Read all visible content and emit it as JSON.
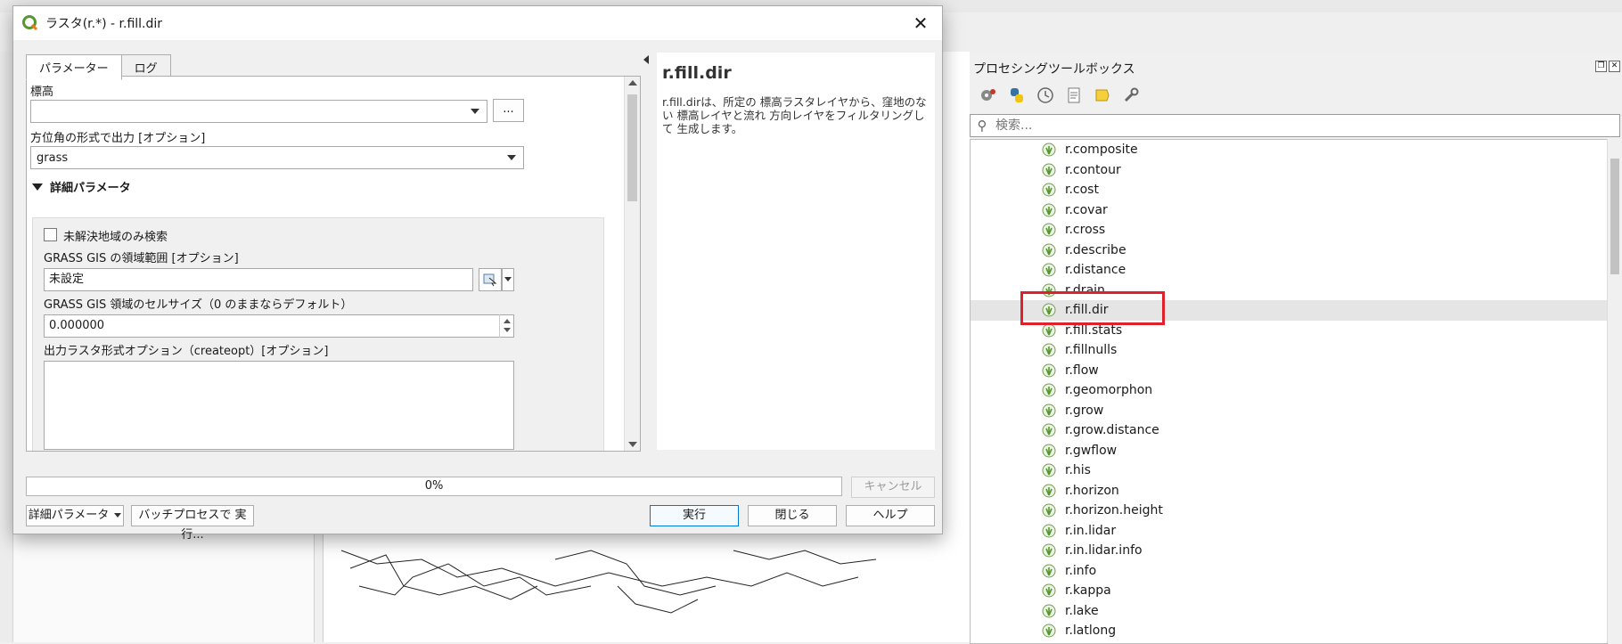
{
  "dialog": {
    "title": "ラスタ(r.*) - r.fill.dir",
    "tabs": [
      {
        "label": "パラメーター",
        "active": true
      },
      {
        "label": "ログ",
        "active": false
      }
    ],
    "params": {
      "elevation_label": "標高",
      "elevation_value": "",
      "browse_label": "...",
      "direction_format_label": "方位角の形式で出力 [オプション]",
      "direction_format_value": "grass",
      "advanced_section_label": "詳細パラメータ",
      "unresolved_checkbox_label": "未解決地域のみ検索",
      "unresolved_checked": false,
      "region_extent_label": "GRASS GIS の領域範囲 [オプション]",
      "region_extent_value": "未設定",
      "cellsize_label": "GRASS GIS 領域のセルサイズ（0 のままならデフォルト）",
      "cellsize_value": "0.000000",
      "createopt_label": "出力ラスタ形式オプション（createopt）[オプション]",
      "createopt_value": ""
    },
    "help": {
      "title": "r.fill.dir",
      "text": "r.fill.dirは、所定の 標高ラスタレイヤから、窪地のない 標高レイヤと流れ 方向レイヤをフィルタリングして 生成します。"
    },
    "progress": {
      "text": "0%",
      "value": 0
    },
    "buttons": {
      "cancel": "キャンセル",
      "advanced": "詳細パラメータ",
      "batch": "バッチプロセスで 実行...",
      "run": "実行",
      "close": "閉じる",
      "help": "ヘルプ"
    }
  },
  "toolbox": {
    "title": "プロセシングツールボックス",
    "search_placeholder": "検索...",
    "icons": [
      "models-icon",
      "python-icon",
      "history-icon",
      "results-icon",
      "edit-rendering-styles-icon",
      "options-icon"
    ],
    "items": [
      {
        "label": "r.composite",
        "selected": false
      },
      {
        "label": "r.contour",
        "selected": false
      },
      {
        "label": "r.cost",
        "selected": false
      },
      {
        "label": "r.covar",
        "selected": false
      },
      {
        "label": "r.cross",
        "selected": false
      },
      {
        "label": "r.describe",
        "selected": false
      },
      {
        "label": "r.distance",
        "selected": false
      },
      {
        "label": "r.drain",
        "selected": false
      },
      {
        "label": "r.fill.dir",
        "selected": true
      },
      {
        "label": "r.fill.stats",
        "selected": false
      },
      {
        "label": "r.fillnulls",
        "selected": false
      },
      {
        "label": "r.flow",
        "selected": false
      },
      {
        "label": "r.geomorphon",
        "selected": false
      },
      {
        "label": "r.grow",
        "selected": false
      },
      {
        "label": "r.grow.distance",
        "selected": false
      },
      {
        "label": "r.gwflow",
        "selected": false
      },
      {
        "label": "r.his",
        "selected": false
      },
      {
        "label": "r.horizon",
        "selected": false
      },
      {
        "label": "r.horizon.height",
        "selected": false
      },
      {
        "label": "r.in.lidar",
        "selected": false
      },
      {
        "label": "r.in.lidar.info",
        "selected": false
      },
      {
        "label": "r.info",
        "selected": false
      },
      {
        "label": "r.kappa",
        "selected": false
      },
      {
        "label": "r.lake",
        "selected": false
      },
      {
        "label": "r.latlong",
        "selected": false
      }
    ]
  },
  "colors": {
    "highlight": "#e0202a",
    "qgis_green": "#589632",
    "selection_bg": "#e5e5e5",
    "primary_button_border": "#0078d7"
  }
}
